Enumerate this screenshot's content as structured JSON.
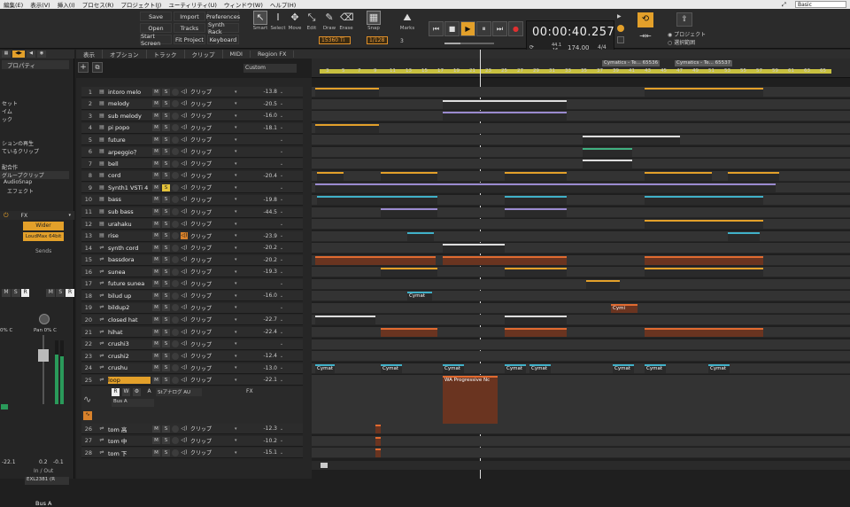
{
  "menu": {
    "items": [
      "編集(E)",
      "表示(V)",
      "挿入(I)",
      "プロセス(R)",
      "プロジェクト(J)",
      "ユーティリティ(U)",
      "ウィンドウ(W)",
      "ヘルプ(H)"
    ],
    "preset": "Basic"
  },
  "toolbar": {
    "buttons": [
      "Save",
      "Import",
      "Preferences",
      "Open",
      "Tracks",
      "Synth Rack",
      "Start Screen",
      "Fit Project",
      "Keyboard"
    ],
    "tools": [
      "Smart",
      "Select",
      "Move",
      "Edit",
      "Draw",
      "Erase"
    ],
    "tool_value": "15360 Ti",
    "snap_label": "Snap",
    "snap_value": "1/128",
    "marks_label": "Marks",
    "marks_value": "3"
  },
  "transport": {
    "time": "00:00:40.257",
    "sample_rate_top": "44.1",
    "sample_rate_bottom": "16",
    "tempo": "174.00",
    "meter": "4/4",
    "opt1": "プロジェクト",
    "opt2": "選択範囲"
  },
  "inspector": {
    "title": "プロパティ",
    "rows": [
      "セット",
      "イム",
      "ック",
      "ションの再生",
      "ているクリップ",
      "配合作",
      "グループクリップ",
      "AudioSnap",
      "エフェクト"
    ],
    "fx_label": "FX",
    "fx1": "Wider",
    "fx2": "LoudMax 64bit",
    "sends_label": "Sends",
    "pan_label": "Pan 0% C",
    "pan_label2": "0% C",
    "level1": "-22.1",
    "level2": "0.2",
    "level3": "-0.1",
    "io_label": "In / Out",
    "io_value": "EXL2381 (R",
    "bus": "Bus A"
  },
  "view_tabs": [
    "表示",
    "オプション",
    "トラック",
    "クリップ",
    "MIDI",
    "Region FX"
  ],
  "custom_label": "Custom",
  "tracks": [
    {
      "n": "1",
      "name": "intoro melo",
      "vol": "-13.8",
      "icon": "M"
    },
    {
      "n": "2",
      "name": "melody",
      "vol": "-20.5",
      "icon": "M"
    },
    {
      "n": "3",
      "name": "sub melody",
      "vol": "-16.0",
      "icon": "M"
    },
    {
      "n": "4",
      "name": "pi popo",
      "vol": "-18.1",
      "icon": "M"
    },
    {
      "n": "5",
      "name": "future",
      "vol": "",
      "icon": "M"
    },
    {
      "n": "6",
      "name": "arpeggio？",
      "vol": "",
      "icon": "M"
    },
    {
      "n": "7",
      "name": "bell",
      "vol": "",
      "icon": "M"
    },
    {
      "n": "8",
      "name": "cord",
      "vol": "-20.4",
      "icon": "M"
    },
    {
      "n": "9",
      "name": "Synth1 VSTi 4",
      "vol": "",
      "icon": "M"
    },
    {
      "n": "10",
      "name": "bass",
      "vol": "-19.8",
      "icon": "M"
    },
    {
      "n": "11",
      "name": "sub bass",
      "vol": "-44.5",
      "icon": "M"
    },
    {
      "n": "12",
      "name": "urahaku",
      "vol": "",
      "icon": "M"
    },
    {
      "n": "13",
      "name": "rise",
      "vol": "-23.9",
      "icon": "M"
    },
    {
      "n": "14",
      "name": "synth cord",
      "vol": "-20.2",
      "icon": "A"
    },
    {
      "n": "15",
      "name": "bassdora",
      "vol": "-20.2",
      "icon": "A"
    },
    {
      "n": "16",
      "name": "sunea",
      "vol": "-19.3",
      "icon": "A"
    },
    {
      "n": "17",
      "name": "future sunea",
      "vol": "",
      "icon": "A"
    },
    {
      "n": "18",
      "name": "bilud up",
      "vol": "-16.0",
      "icon": "A"
    },
    {
      "n": "19",
      "name": "bildup2",
      "vol": "",
      "icon": "A"
    },
    {
      "n": "20",
      "name": "closed hat",
      "vol": "-22.7",
      "icon": "A"
    },
    {
      "n": "21",
      "name": "hihat",
      "vol": "-22.4",
      "icon": "A"
    },
    {
      "n": "22",
      "name": "crushi3",
      "vol": "",
      "icon": "A"
    },
    {
      "n": "23",
      "name": "crushi2",
      "vol": "-12.4",
      "icon": "A"
    },
    {
      "n": "24",
      "name": "crushu",
      "vol": "-13.0",
      "icon": "A"
    },
    {
      "n": "25",
      "name": "loop",
      "vol": "-22.1",
      "icon": "A"
    },
    {
      "n": "26",
      "name": "tom 高",
      "vol": "-12.3",
      "icon": "A"
    },
    {
      "n": "27",
      "name": "tom 中",
      "vol": "-10.2",
      "icon": "A"
    },
    {
      "n": "28",
      "name": "tom 下",
      "vol": "-15.1",
      "icon": "A"
    }
  ],
  "clip_label": "クリップ",
  "loop_detail": {
    "input": "Stアナログ AU",
    "bus": "Bus A",
    "fx": "FX"
  },
  "ruler_ticks": [
    "3",
    "5",
    "7",
    "9",
    "11",
    "13",
    "15",
    "17",
    "19",
    "21",
    "23",
    "25",
    "27",
    "29",
    "31",
    "33",
    "35",
    "37",
    "39",
    "41",
    "43",
    "45",
    "47",
    "49",
    "51",
    "53",
    "55",
    "57",
    "59",
    "61",
    "63",
    "65"
  ],
  "markers": [
    "Cymatics - Te... 65536",
    "Cymatics - Te... 65537"
  ],
  "clip_names": {
    "cymat": "Cymat",
    "cymi": "Cymi",
    "wa": "WA Progressive Nc"
  }
}
